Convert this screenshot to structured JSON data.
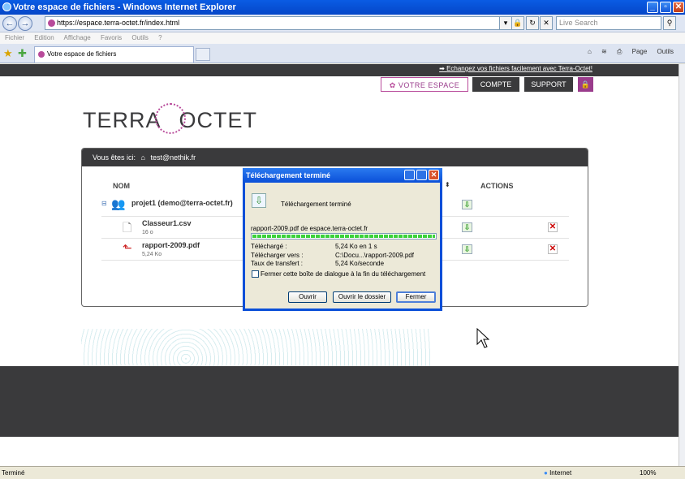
{
  "window": {
    "title": "Votre espace de fichiers - Windows Internet Explorer"
  },
  "address": {
    "url": "https://espace.terra-octet.fr/index.html",
    "search_placeholder": "Live Search"
  },
  "menu": [
    "Fichier",
    "Edition",
    "Affichage",
    "Favoris",
    "Outils",
    "?"
  ],
  "tab": {
    "label": "Votre espace de fichiers"
  },
  "toolbar": {
    "page": "Page",
    "tools": "Outils"
  },
  "site": {
    "top_link": "Echangez vos fichiers facilement avec Terra-Octet!",
    "nav": {
      "espace": "VOTRE ESPACE",
      "compte": "COMPTE",
      "support": "SUPPORT"
    },
    "logo_left": "TERRA",
    "logo_right": "OCTET",
    "breadcrumb_label": "Vous êtes ici:",
    "breadcrumb_user": "test@nethik.fr",
    "col_name": "NOM",
    "col_actions": "ACTIONS",
    "rows": [
      {
        "title": "projet1 (demo@terra-octet.fr)",
        "sub": ""
      },
      {
        "title": "Classeur1.csv",
        "sub": "16 o"
      },
      {
        "title": "rapport-2009.pdf",
        "sub": "5,24 Ko"
      }
    ]
  },
  "dialog": {
    "title": "Téléchargement terminé",
    "heading": "Téléchargement terminé",
    "file": "rapport-2009.pdf de espace.terra-octet.fr",
    "progress": 1.0,
    "rows": [
      {
        "label": "Téléchargé :",
        "value": "5,24 Ko en 1 s"
      },
      {
        "label": "Télécharger vers :",
        "value": "C:\\Docu...\\rapport-2009.pdf"
      },
      {
        "label": "Taux de transfert :",
        "value": "5,24 Ko/seconde"
      }
    ],
    "checkbox_label": "Fermer cette boîte de dialogue à la fin du téléchargement",
    "buttons": {
      "open": "Ouvrir",
      "open_folder": "Ouvrir le dossier",
      "close": "Fermer"
    }
  },
  "status": {
    "text": "Terminé",
    "zone": "Internet",
    "zoom": "100%"
  }
}
